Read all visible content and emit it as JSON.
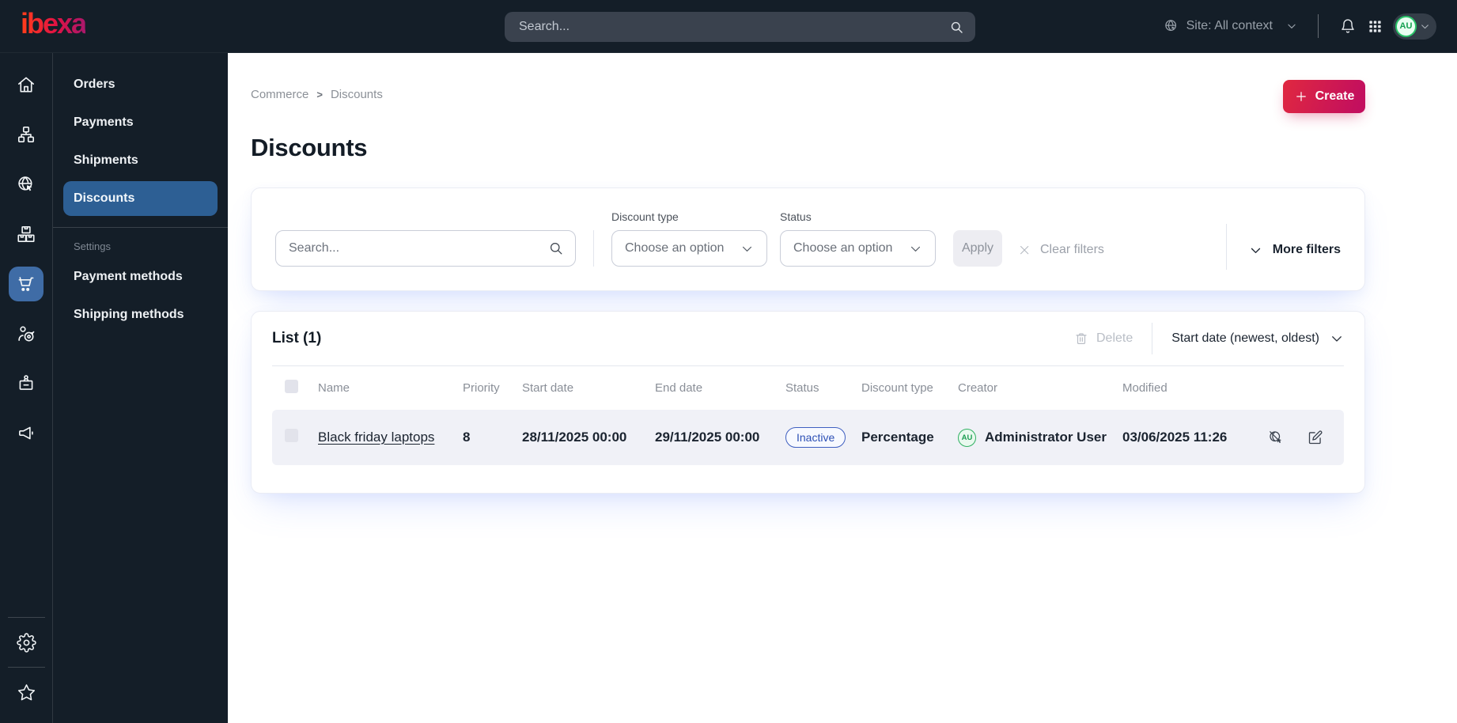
{
  "brand": {
    "logo": "ibexa"
  },
  "topbar": {
    "search_placeholder": "Search...",
    "site_context_label": "Site: All context",
    "avatar_initials": "AU"
  },
  "icon_rail": {
    "items": [
      "home",
      "content-tree",
      "site",
      "products",
      "commerce",
      "personalization",
      "corporate",
      "marketing",
      "settings",
      "bookmarks"
    ],
    "active_item": "commerce"
  },
  "sidebar": {
    "items": [
      "Orders",
      "Payments",
      "Shipments",
      "Discounts"
    ],
    "active_item": "Discounts",
    "section_label": "Settings",
    "section_items": [
      "Payment methods",
      "Shipping methods"
    ]
  },
  "breadcrumb": {
    "items": [
      "Commerce",
      "Discounts"
    ],
    "separator": ">"
  },
  "page": {
    "title": "Discounts",
    "create_button": "Create"
  },
  "filters": {
    "search_placeholder": "Search...",
    "discount_type_label": "Discount type",
    "discount_type_value": "Choose an option",
    "status_label": "Status",
    "status_value": "Choose an option",
    "apply_button": "Apply",
    "clear_button": "Clear filters",
    "more_filters_button": "More filters"
  },
  "list": {
    "heading": "List (1)",
    "delete_button": "Delete",
    "sort_button": "Start date (newest, oldest)",
    "columns": [
      "Name",
      "Priority",
      "Start date",
      "End date",
      "Status",
      "Discount type",
      "Creator",
      "Modified"
    ],
    "rows": [
      {
        "name": "Black friday laptops",
        "priority": "8",
        "start_date": "28/11/2025 00:00",
        "end_date": "29/11/2025 00:00",
        "status": "Inactive",
        "discount_type": "Percentage",
        "creator_initials": "AU",
        "creator": "Administrator User",
        "modified": "03/06/2025 11:26"
      }
    ]
  },
  "colors": {
    "dark_bg": "#141e28",
    "brand_gradient_start": "#ff3b1d",
    "brand_gradient_end": "#a8186c",
    "primary_gradient_start": "#e02840",
    "primary_gradient_end": "#c30f5e",
    "active_nav_blue": "#2d5f94",
    "active_icon_blue": "#3f6ca6",
    "status_inactive_blue": "#3f5fc0",
    "avatar_green": "#29c268",
    "row_bg": "#f0f1f7"
  }
}
